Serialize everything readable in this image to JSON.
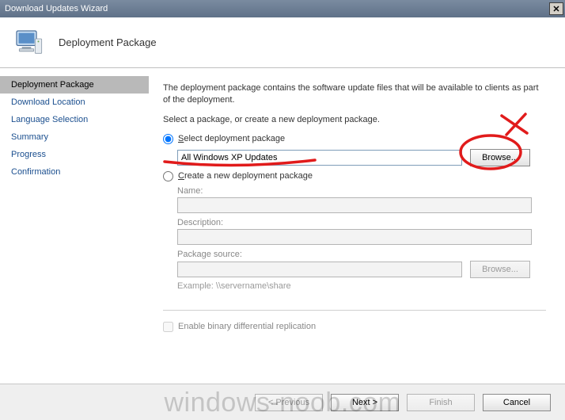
{
  "window": {
    "title": "Download Updates Wizard",
    "close_glyph": "✕"
  },
  "header": {
    "heading": "Deployment Package"
  },
  "sidebar": {
    "items": [
      {
        "label": "Deployment Package",
        "active": true
      },
      {
        "label": "Download Location"
      },
      {
        "label": "Language Selection"
      },
      {
        "label": "Summary"
      },
      {
        "label": "Progress"
      },
      {
        "label": "Confirmation"
      }
    ]
  },
  "content": {
    "intro": "The deployment package contains the software update files that will be available to clients as part of the deployment.",
    "prompt": "Select a package, or create a new deployment package.",
    "radio_select_label": "Select deployment package",
    "radio_create_label": "Create a new deployment package",
    "selected_package": "All Windows XP Updates",
    "browse_label": "Browse...",
    "name_label": "Name:",
    "name_value": "",
    "description_label": "Description:",
    "description_value": "",
    "package_source_label": "Package source:",
    "package_source_value": "",
    "browse2_label": "Browse...",
    "example_label": "Example: \\\\servername\\share",
    "binary_diff_label": "Enable binary differential replication"
  },
  "footer": {
    "previous": "< Previous",
    "next": "Next >",
    "finish": "Finish",
    "cancel": "Cancel"
  },
  "watermark": "windows-noob.com",
  "annotation_color": "#e11b1b"
}
